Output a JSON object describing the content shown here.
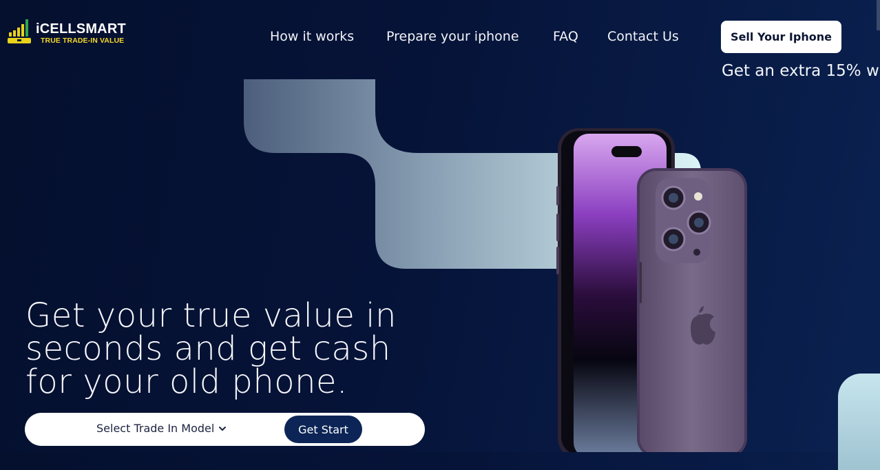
{
  "logo": {
    "title": "iCELLSMART",
    "tagline": "TRUE TRADE-IN VALUE",
    "colors": {
      "bars": "#e8d21a",
      "accent": "#2fa84f"
    }
  },
  "nav": {
    "items": [
      "How it works",
      "Prepare your iphone",
      "FAQ",
      "Contact Us"
    ]
  },
  "cta": {
    "sell_label": "Sell Your Iphone",
    "promo_text": "Get an extra 15% w"
  },
  "hero": {
    "title_lines": [
      "Get your true value in",
      "seconds and get cash",
      "for your old phone."
    ]
  },
  "trade_in": {
    "select_label": "Select Trade In Model",
    "submit_label": "Get Start"
  },
  "colors": {
    "background": "#061338",
    "button_dark": "#0c2556",
    "phone_purple": "#6b5a7a",
    "shape_light": "#d7f0f4"
  }
}
